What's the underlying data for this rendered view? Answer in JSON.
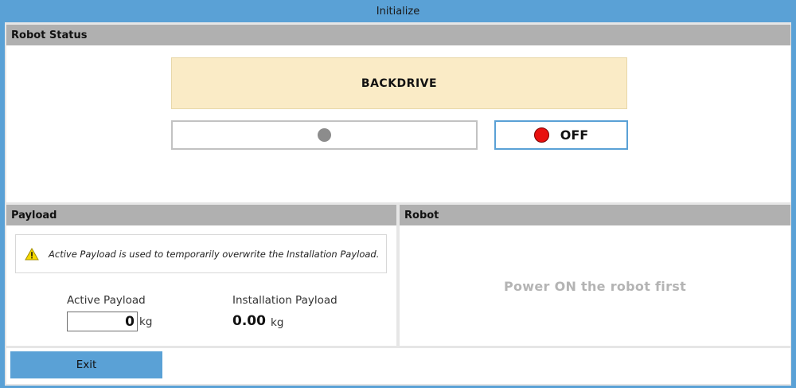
{
  "window": {
    "title": "Initialize"
  },
  "robot_status": {
    "header": "Robot Status",
    "mode": "BACKDRIVE",
    "power_button_label": "OFF"
  },
  "payload": {
    "header": "Payload",
    "info_text": "Active Payload is used to temporarily overwrite the Installation Payload.",
    "active_label": "Active Payload",
    "active_value": "0",
    "active_unit": "kg",
    "installation_label": "Installation Payload",
    "installation_value": "0.00",
    "installation_unit": "kg"
  },
  "robot": {
    "header": "Robot",
    "message": "Power ON the robot first"
  },
  "footer": {
    "exit_label": "Exit"
  },
  "colors": {
    "accent": "#5aa1d6",
    "mode_banner": "#faebc6",
    "power_off_indicator": "#e8100f",
    "status_indicator": "#8c8c8c",
    "warning": "#f5d800"
  },
  "icons": {
    "warning": "warning-icon",
    "status": "status-dot-icon",
    "power": "power-state-icon"
  }
}
